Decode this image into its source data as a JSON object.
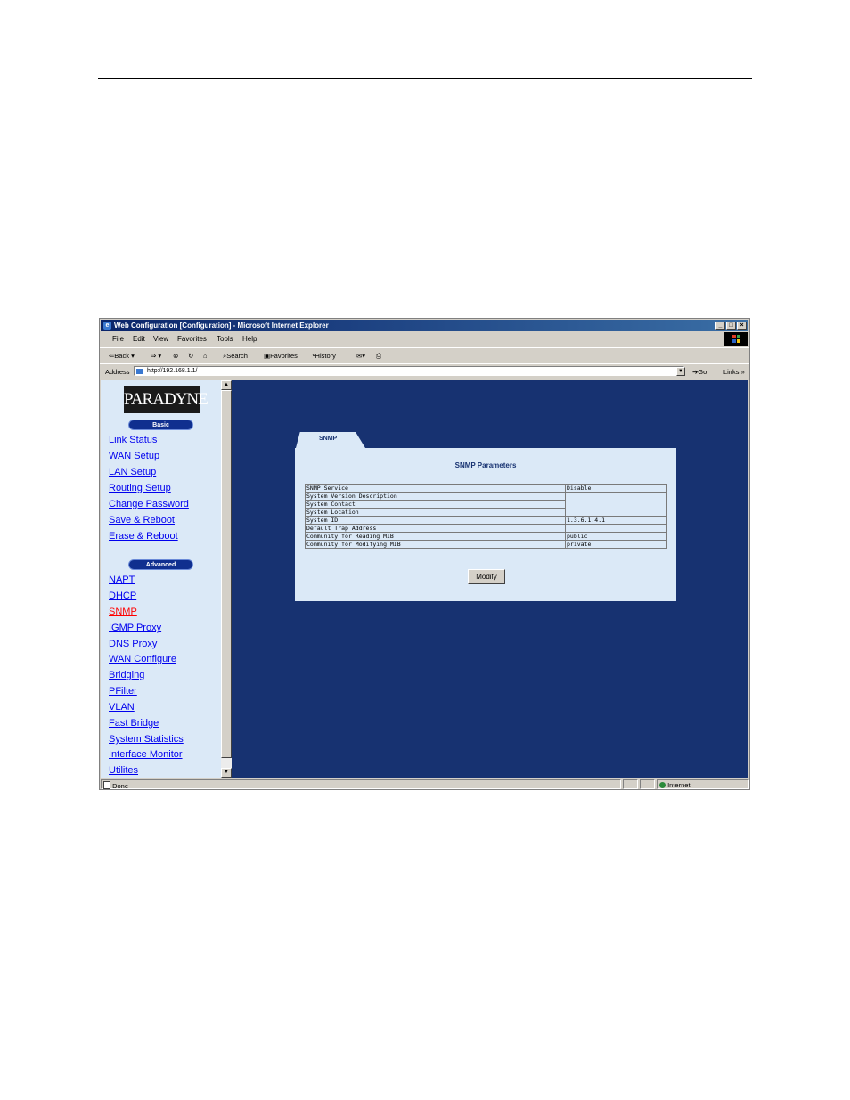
{
  "window": {
    "title": "Web Configuration [Configuration] - Microsoft Internet Explorer",
    "controls": [
      "_",
      "□",
      "×"
    ]
  },
  "menu": [
    "File",
    "Edit",
    "View",
    "Favorites",
    "Tools",
    "Help"
  ],
  "toolbar": {
    "back": "Back",
    "search": "Search",
    "favorites": "Favorites",
    "history": "History"
  },
  "address": {
    "label": "Address",
    "url": "http://192.168.1.1/",
    "go": "Go",
    "links": "Links"
  },
  "sidebar": {
    "logo": "PARADYNE",
    "basic_label": "Basic",
    "basic_items": [
      "Link Status",
      "WAN Setup",
      "LAN Setup",
      "Routing Setup",
      "Change Password",
      "Save & Reboot",
      "Erase & Reboot"
    ],
    "advanced_label": "Advanced",
    "advanced_items": [
      "NAPT",
      "DHCP",
      "SNMP",
      "IGMP Proxy",
      "DNS Proxy",
      "WAN Configure",
      "Bridging",
      "PFilter",
      "VLAN",
      "Fast Bridge",
      "System Statistics",
      "Interface Monitor",
      "Utilites"
    ],
    "active_item": "SNMP"
  },
  "main": {
    "tab_label": "SNMP",
    "title": "SNMP Parameters",
    "rows": [
      {
        "label": "SNMP Service",
        "value": "Disable"
      },
      {
        "label": "System Version Description",
        "value": ""
      },
      {
        "label": "System Contact",
        "value": ""
      },
      {
        "label": "System Location",
        "value": ""
      },
      {
        "label": "System ID",
        "value": "1.3.6.1.4.1"
      },
      {
        "label": "Default Trap Address",
        "value": ""
      },
      {
        "label": "Community for Reading MIB",
        "value": "public"
      },
      {
        "label": "Community for Modifying MIB",
        "value": "private"
      }
    ],
    "modify_button": "Modify"
  },
  "status": {
    "text": "Done",
    "zone": "Internet"
  },
  "colors": {
    "content_bg": "#173271",
    "panel_bg": "#dbe9f7",
    "link": "#0000ee",
    "active_link": "#ff0000"
  }
}
